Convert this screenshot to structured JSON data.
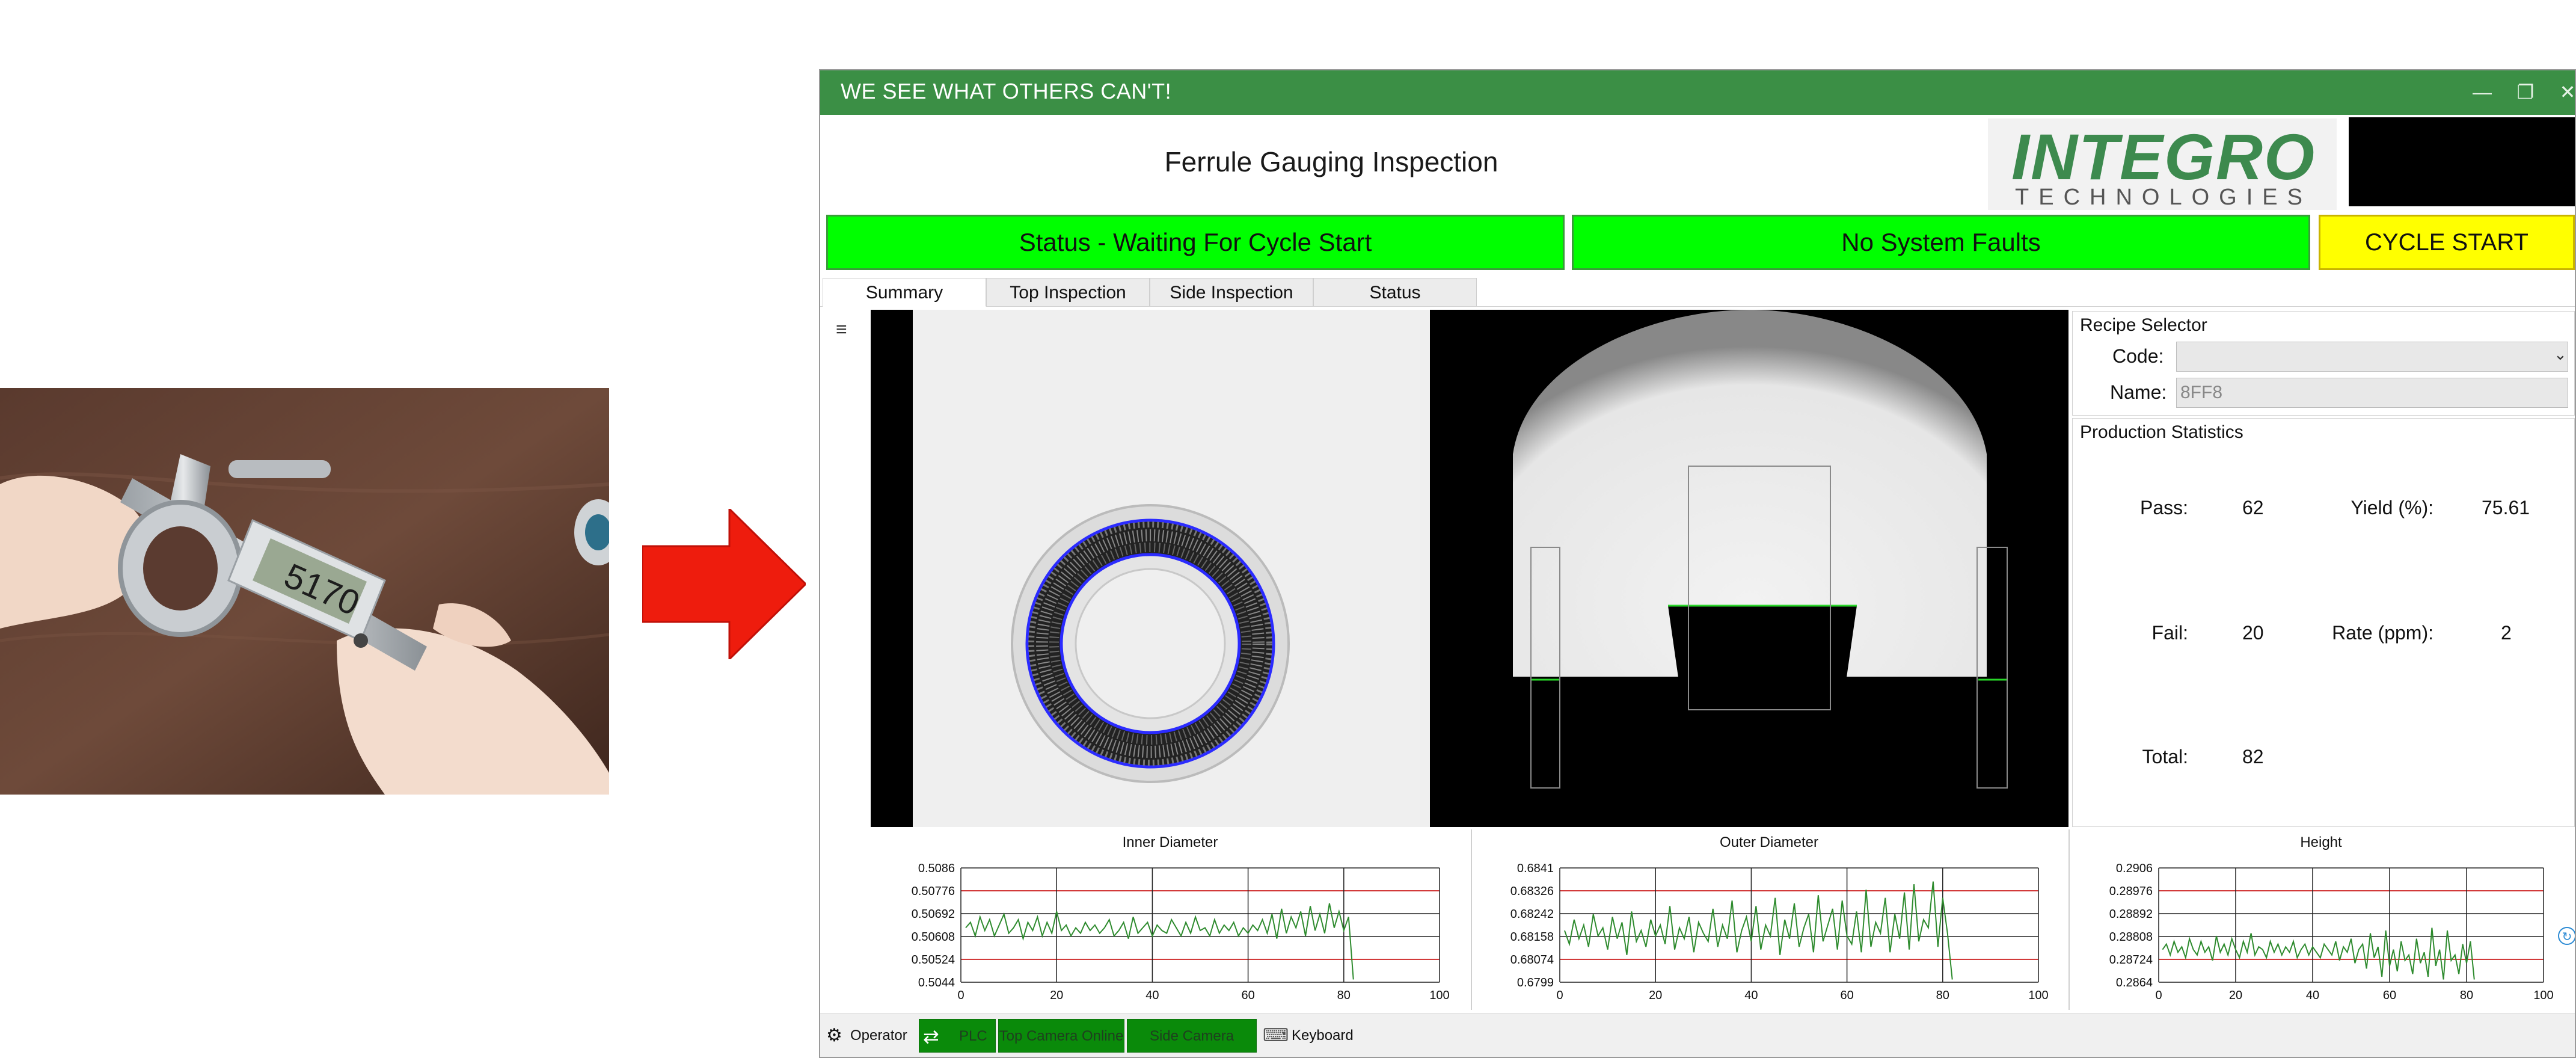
{
  "window": {
    "title": "WE SEE WHAT OTHERS CAN'T!",
    "app_title": "Ferrule Gauging Inspection",
    "logo_line1": "INTEGRO",
    "logo_line2": "TECHNOLOGIES"
  },
  "status": {
    "cycle_status": "Status - Waiting For Cycle Start",
    "faults": "No System Faults",
    "cycle_start_label": "CYCLE START"
  },
  "tabs": [
    {
      "label": "Summary",
      "active": true
    },
    {
      "label": "Top Inspection",
      "active": false
    },
    {
      "label": "Side Inspection",
      "active": false
    },
    {
      "label": "Status",
      "active": false
    }
  ],
  "recipe": {
    "group_label": "Recipe Selector",
    "code_label": "Code:",
    "code_value": "",
    "name_label": "Name:",
    "name_value": "8FF8"
  },
  "production": {
    "group_label": "Production Statistics",
    "pass_label": "Pass:",
    "pass_value": "62",
    "fail_label": "Fail:",
    "fail_value": "20",
    "total_label": "Total:",
    "total_value": "82",
    "yield_label": "Yield (%):",
    "yield_value": "75.61",
    "rate_label": "Rate (ppm):",
    "rate_value": "2"
  },
  "chart_data": [
    {
      "type": "line",
      "title": "Inner Diameter",
      "xlim": [
        0,
        100
      ],
      "xticks": [
        "0",
        "20",
        "40",
        "60",
        "80",
        "100"
      ],
      "yticks": [
        "0.5086",
        "0.50776",
        "0.50692",
        "0.50608",
        "0.50524",
        "0.5044"
      ],
      "ylim": [
        0.5044,
        0.5086
      ],
      "limits": [
        0.50776,
        0.50524
      ],
      "series": [
        {
          "values": [
            0.5064,
            0.5066,
            0.5061,
            0.5068,
            0.5063,
            0.5067,
            0.5061,
            0.5065,
            0.5069,
            0.5062,
            0.5064,
            0.5067,
            0.506,
            0.5066,
            0.5063,
            0.5068,
            0.5061,
            0.5066,
            0.5062,
            0.507,
            0.5063,
            0.5065,
            0.5061,
            0.5064,
            0.5062,
            0.5066,
            0.5063,
            0.5065,
            0.5062,
            0.5064,
            0.5067,
            0.5061,
            0.5063,
            0.5066,
            0.506,
            0.5068,
            0.5062,
            0.5064,
            0.5066,
            0.5061,
            0.5065,
            0.5063,
            0.5062,
            0.5067,
            0.5064,
            0.5061,
            0.5066,
            0.5062,
            0.5068,
            0.5063,
            0.5064,
            0.5061,
            0.5067,
            0.5062,
            0.5065,
            0.5063,
            0.5066,
            0.5061,
            0.5064,
            0.5062,
            0.5065,
            0.5063,
            0.5067,
            0.5062,
            0.5069,
            0.506,
            0.5071,
            0.5062,
            0.5068,
            0.5064,
            0.507,
            0.5061,
            0.5072,
            0.5063,
            0.5069,
            0.5062,
            0.5073,
            0.5064,
            0.507,
            0.5063,
            0.5068,
            0.5045
          ]
        }
      ],
      "color": "#2e8b2e"
    },
    {
      "type": "line",
      "title": "Outer Diameter",
      "xlim": [
        0,
        100
      ],
      "xticks": [
        "0",
        "20",
        "40",
        "60",
        "80",
        "100"
      ],
      "yticks": [
        "0.6841",
        "0.68326",
        "0.68242",
        "0.68158",
        "0.68074",
        "0.6799"
      ],
      "ylim": [
        0.6799,
        0.6841
      ],
      "limits": [
        0.68326,
        0.68074
      ],
      "series": [
        {
          "values": [
            0.6818,
            0.6813,
            0.6822,
            0.6815,
            0.682,
            0.6812,
            0.6824,
            0.6816,
            0.6819,
            0.6811,
            0.6823,
            0.6815,
            0.6821,
            0.6809,
            0.6825,
            0.6814,
            0.6818,
            0.6812,
            0.6822,
            0.6816,
            0.682,
            0.6813,
            0.6827,
            0.6811,
            0.6819,
            0.6815,
            0.6823,
            0.681,
            0.6821,
            0.6817,
            0.6814,
            0.6826,
            0.6812,
            0.682,
            0.6815,
            0.6829,
            0.681,
            0.6818,
            0.6823,
            0.6814,
            0.6827,
            0.6811,
            0.682,
            0.6816,
            0.683,
            0.6809,
            0.6822,
            0.6815,
            0.6828,
            0.6812,
            0.6819,
            0.6824,
            0.681,
            0.6831,
            0.6814,
            0.682,
            0.6826,
            0.6811,
            0.6829,
            0.6816,
            0.6813,
            0.6825,
            0.681,
            0.6833,
            0.6812,
            0.6821,
            0.6817,
            0.683,
            0.681,
            0.6824,
            0.6815,
            0.6832,
            0.6811,
            0.6835,
            0.6814,
            0.6822,
            0.6819,
            0.6836,
            0.6812,
            0.683,
            0.6817,
            0.68
          ]
        }
      ],
      "color": "#2e8b2e"
    },
    {
      "type": "line",
      "title": "Height",
      "xlim": [
        0,
        100
      ],
      "xticks": [
        "0",
        "20",
        "40",
        "60",
        "80",
        "100"
      ],
      "yticks": [
        "0.2906",
        "0.28976",
        "0.28892",
        "0.28808",
        "0.28724",
        "0.2864"
      ],
      "ylim": [
        0.2864,
        0.2906
      ],
      "limits": [
        0.28976,
        0.28724
      ],
      "series": [
        {
          "values": [
            0.2876,
            0.2878,
            0.2874,
            0.2879,
            0.2875,
            0.2877,
            0.2873,
            0.288,
            0.2876,
            0.2874,
            0.2879,
            0.2875,
            0.2877,
            0.2872,
            0.2881,
            0.2875,
            0.2878,
            0.2874,
            0.288,
            0.2876,
            0.2873,
            0.2879,
            0.2875,
            0.2882,
            0.2874,
            0.2877,
            0.2876,
            0.2873,
            0.2879,
            0.2875,
            0.2878,
            0.2874,
            0.2877,
            0.2875,
            0.2879,
            0.2873,
            0.2876,
            0.2878,
            0.2874,
            0.2877,
            0.2875,
            0.2873,
            0.2878,
            0.2876,
            0.2874,
            0.2879,
            0.2872,
            0.2877,
            0.2875,
            0.288,
            0.2871,
            0.2876,
            0.2878,
            0.2869,
            0.2882,
            0.2873,
            0.2877,
            0.2866,
            0.2883,
            0.287,
            0.2876,
            0.2868,
            0.2879,
            0.2872,
            0.2874,
            0.2867,
            0.288,
            0.2871,
            0.2875,
            0.2866,
            0.2884,
            0.287,
            0.2876,
            0.2865,
            0.2883,
            0.2872,
            0.2874,
            0.2867,
            0.2878,
            0.2871,
            0.2879,
            0.2865
          ]
        }
      ],
      "color": "#2e8b2e"
    }
  ],
  "bottombar": {
    "operator": "Operator",
    "plc": "PLC",
    "top_camera": "Top Camera Online",
    "side_camera": "Side Camera Online",
    "keyboard": "Keyboard"
  }
}
